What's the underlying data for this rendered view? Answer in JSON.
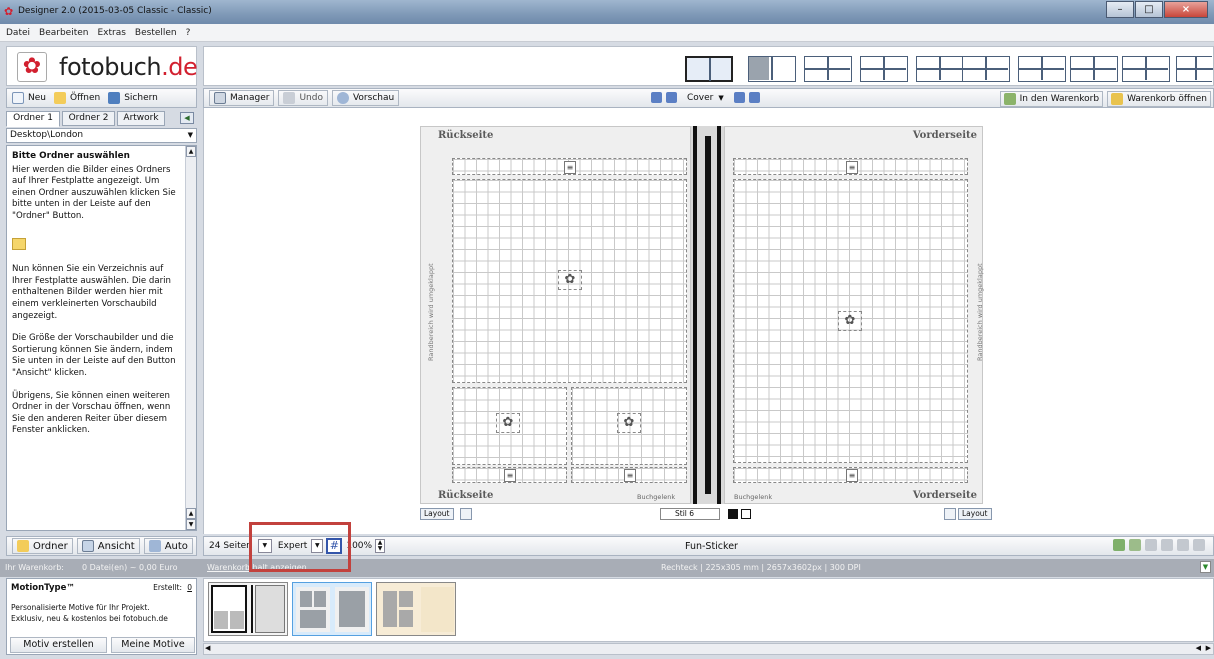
{
  "window": {
    "title": "Designer 2.0 (2015-03-05 Classic - Classic)"
  },
  "menu": [
    "Datei",
    "Bearbeiten",
    "Extras",
    "Bestellen",
    "?"
  ],
  "logo": {
    "text_main": "fotobuch",
    "text_suffix": ".de"
  },
  "left_toolbar": {
    "new": "Neu",
    "open": "Öffnen",
    "save": "Sichern"
  },
  "main_toolbar": {
    "manager": "Manager",
    "undo": "Undo",
    "preview": "Vorschau",
    "cover": "Cover",
    "cart_add": "In den Warenkorb",
    "cart_open": "Warenkorb öffnen"
  },
  "tabs": [
    "Ordner 1",
    "Ordner 2",
    "Artwork"
  ],
  "path": "Desktop\\London",
  "help": {
    "heading": "Bitte Ordner auswählen",
    "p1": "Hier werden die Bilder eines Ordners auf Ihrer Festplatte angezeigt. Um einen Ordner auszuwählen klicken Sie bitte unten in der Leiste auf den \"Ordner\" Button.",
    "p2": "Nun können Sie ein Verzeichnis auf Ihrer Festplatte auswählen. Die darin enthaltenen Bilder werden hier mit einem verkleinerten Vorschaubild angezeigt.",
    "p3": "Die Größe der Vorschaubilder und die Sortierung können Sie ändern, indem Sie unten in der Leiste auf den Button \"Ansicht\" klicken.",
    "p4": "Übrigens, Sie können einen weiteren Ordner in der Vorschau öffnen, wenn Sie den anderen Reiter über diesem Fenster anklicken."
  },
  "pages": {
    "back_title": "Rückseite",
    "front_title": "Vorderseite",
    "back_title_bottom": "Rückseite",
    "front_title_bottom": "Vorderseite",
    "spine_label_left": "Buchgelenk",
    "spine_label_right": "Buchgelenk",
    "edge_note": "Randbereich wird umgeklappt"
  },
  "canvas_controls": {
    "layout_left": "Layout",
    "style": "Stil 6",
    "layout_right": "Layout"
  },
  "bottom_left": {
    "folder": "Ordner",
    "view": "Ansicht",
    "auto": "Auto"
  },
  "bottom_controls": {
    "pages": "24 Seiten",
    "mode": "Expert",
    "zoom": "100%",
    "fun_sticker": "Fun-Sticker"
  },
  "status": {
    "cart_label": "Ihr Warenkorb:",
    "cart_value": "0 Datei(en) ~ 0,00 Euro",
    "cart_link": "Warenkorb",
    "cart_link_suffix": "Inhalt anzeigen",
    "info": "Rechteck | 225x305 mm | 2657x3602px | 300 DPI"
  },
  "motion": {
    "title": "MotionType™",
    "created_label": "Erstellt:",
    "created_value": "0",
    "desc1": "Personalisierte Motive für Ihr Projekt.",
    "desc2": "Exklusiv, neu & kostenlos bei fotobuch.de",
    "create_btn": "Motiv erstellen",
    "my_btn": "Meine Motive"
  },
  "colors": {
    "accent_red": "#d2202f",
    "highlight_box": "#c2413d"
  }
}
